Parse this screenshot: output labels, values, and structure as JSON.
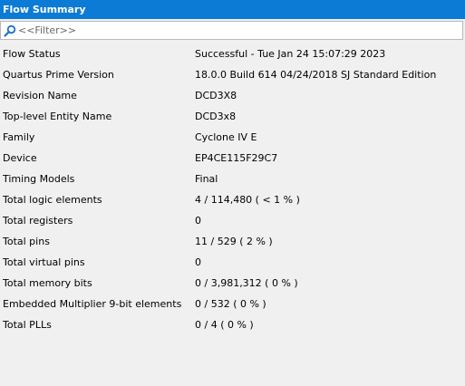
{
  "panel": {
    "title": "Flow Summary"
  },
  "filter": {
    "placeholder": "<<Filter>>",
    "icon": "search-icon"
  },
  "rows": [
    {
      "name": "Flow Status",
      "value": "Successful - Tue Jan 24 15:07:29 2023"
    },
    {
      "name": "Quartus Prime Version",
      "value": "18.0.0 Build 614 04/24/2018 SJ Standard Edition"
    },
    {
      "name": "Revision Name",
      "value": "DCD3X8"
    },
    {
      "name": "Top-level Entity Name",
      "value": "DCD3x8"
    },
    {
      "name": "Family",
      "value": "Cyclone IV E"
    },
    {
      "name": "Device",
      "value": "EP4CE115F29C7"
    },
    {
      "name": "Timing Models",
      "value": "Final"
    },
    {
      "name": "Total logic elements",
      "value": "4 / 114,480 ( < 1 % )"
    },
    {
      "name": "Total registers",
      "value": "0"
    },
    {
      "name": "Total pins",
      "value": "11 / 529 ( 2 % )"
    },
    {
      "name": "Total virtual pins",
      "value": "0"
    },
    {
      "name": "Total memory bits",
      "value": "0 / 3,981,312 ( 0 % )"
    },
    {
      "name": "Embedded Multiplier 9-bit elements",
      "value": "0 / 532 ( 0 % )"
    },
    {
      "name": "Total PLLs",
      "value": "0 / 4 ( 0 % )"
    }
  ],
  "colors": {
    "titlebar": "#0c7bd6",
    "background": "#f0f0f0",
    "icon": "#1f6fd1"
  }
}
